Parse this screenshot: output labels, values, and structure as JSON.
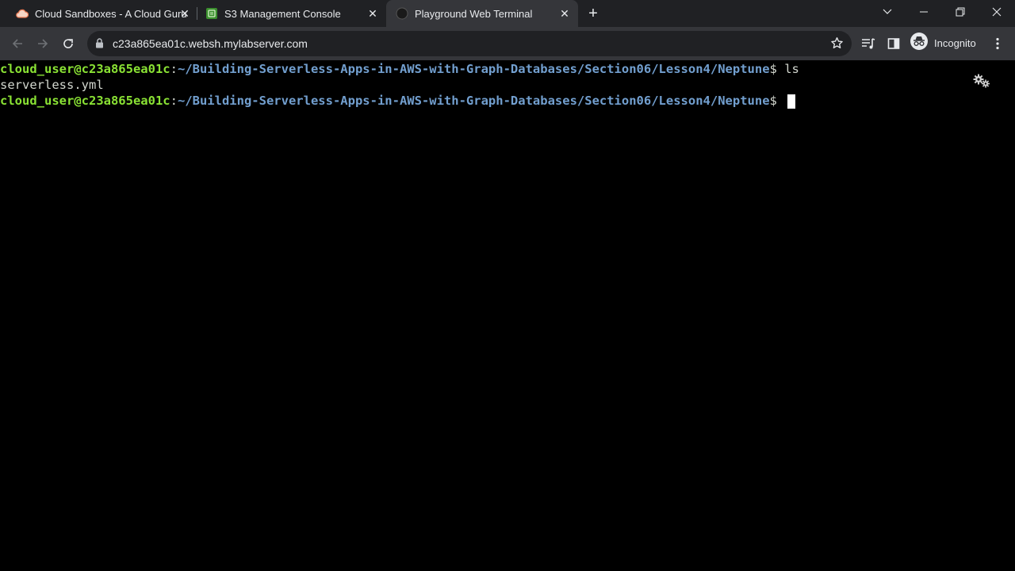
{
  "browser": {
    "tabs": [
      {
        "title": "Cloud Sandboxes - A Cloud Guru",
        "icon": "cloud-icon",
        "active": false
      },
      {
        "title": "S3 Management Console",
        "icon": "s3-icon",
        "active": false
      },
      {
        "title": "Playground Web Terminal",
        "icon": "terminal-favicon",
        "active": true
      }
    ],
    "close_glyph": "✕",
    "new_tab_glyph": "+",
    "url": "c23a865ea01c.websh.mylabserver.com",
    "incognito_label": "Incognito"
  },
  "terminal": {
    "lines": [
      {
        "user": "cloud_user@c23a865ea01c",
        "sep": ":",
        "path": "~/Building-Serverless-Apps-in-AWS-with-Graph-Databases/Section06/Lesson4/Neptune",
        "prompt": "$ ",
        "command": "ls"
      },
      {
        "output": "serverless.yml"
      },
      {
        "user": "cloud_user@c23a865ea01c",
        "sep": ":",
        "path": "~/Building-Serverless-Apps-in-AWS-with-Graph-Databases/Section06/Lesson4/Neptune",
        "prompt": "$ ",
        "command": ""
      }
    ]
  },
  "colors": {
    "user": "#8ae234",
    "path": "#729fcf",
    "tabbar": "#202124",
    "toolbar": "#35363a"
  }
}
